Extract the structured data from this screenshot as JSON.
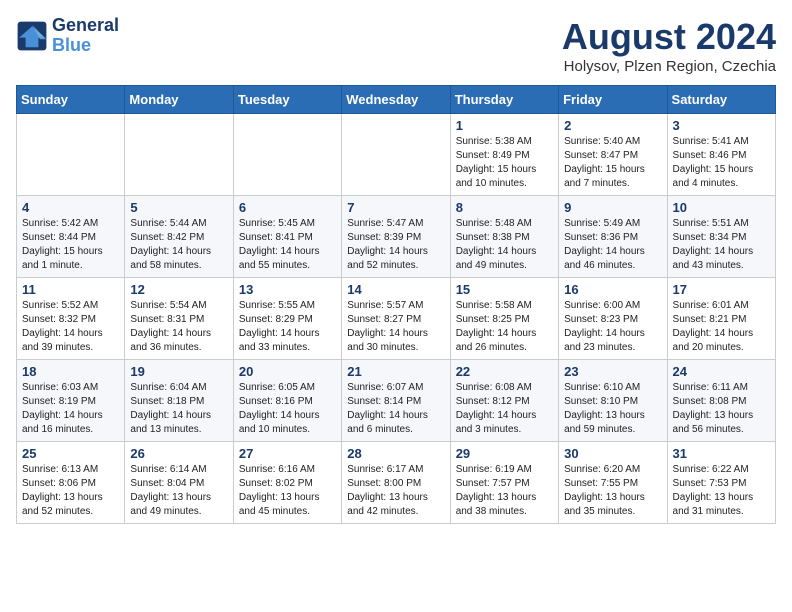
{
  "header": {
    "logo_line1": "General",
    "logo_line2": "Blue",
    "month_year": "August 2024",
    "location": "Holysov, Plzen Region, Czechia"
  },
  "days_of_week": [
    "Sunday",
    "Monday",
    "Tuesday",
    "Wednesday",
    "Thursday",
    "Friday",
    "Saturday"
  ],
  "weeks": [
    [
      {
        "day": "",
        "info": ""
      },
      {
        "day": "",
        "info": ""
      },
      {
        "day": "",
        "info": ""
      },
      {
        "day": "",
        "info": ""
      },
      {
        "day": "1",
        "info": "Sunrise: 5:38 AM\nSunset: 8:49 PM\nDaylight: 15 hours\nand 10 minutes."
      },
      {
        "day": "2",
        "info": "Sunrise: 5:40 AM\nSunset: 8:47 PM\nDaylight: 15 hours\nand 7 minutes."
      },
      {
        "day": "3",
        "info": "Sunrise: 5:41 AM\nSunset: 8:46 PM\nDaylight: 15 hours\nand 4 minutes."
      }
    ],
    [
      {
        "day": "4",
        "info": "Sunrise: 5:42 AM\nSunset: 8:44 PM\nDaylight: 15 hours\nand 1 minute."
      },
      {
        "day": "5",
        "info": "Sunrise: 5:44 AM\nSunset: 8:42 PM\nDaylight: 14 hours\nand 58 minutes."
      },
      {
        "day": "6",
        "info": "Sunrise: 5:45 AM\nSunset: 8:41 PM\nDaylight: 14 hours\nand 55 minutes."
      },
      {
        "day": "7",
        "info": "Sunrise: 5:47 AM\nSunset: 8:39 PM\nDaylight: 14 hours\nand 52 minutes."
      },
      {
        "day": "8",
        "info": "Sunrise: 5:48 AM\nSunset: 8:38 PM\nDaylight: 14 hours\nand 49 minutes."
      },
      {
        "day": "9",
        "info": "Sunrise: 5:49 AM\nSunset: 8:36 PM\nDaylight: 14 hours\nand 46 minutes."
      },
      {
        "day": "10",
        "info": "Sunrise: 5:51 AM\nSunset: 8:34 PM\nDaylight: 14 hours\nand 43 minutes."
      }
    ],
    [
      {
        "day": "11",
        "info": "Sunrise: 5:52 AM\nSunset: 8:32 PM\nDaylight: 14 hours\nand 39 minutes."
      },
      {
        "day": "12",
        "info": "Sunrise: 5:54 AM\nSunset: 8:31 PM\nDaylight: 14 hours\nand 36 minutes."
      },
      {
        "day": "13",
        "info": "Sunrise: 5:55 AM\nSunset: 8:29 PM\nDaylight: 14 hours\nand 33 minutes."
      },
      {
        "day": "14",
        "info": "Sunrise: 5:57 AM\nSunset: 8:27 PM\nDaylight: 14 hours\nand 30 minutes."
      },
      {
        "day": "15",
        "info": "Sunrise: 5:58 AM\nSunset: 8:25 PM\nDaylight: 14 hours\nand 26 minutes."
      },
      {
        "day": "16",
        "info": "Sunrise: 6:00 AM\nSunset: 8:23 PM\nDaylight: 14 hours\nand 23 minutes."
      },
      {
        "day": "17",
        "info": "Sunrise: 6:01 AM\nSunset: 8:21 PM\nDaylight: 14 hours\nand 20 minutes."
      }
    ],
    [
      {
        "day": "18",
        "info": "Sunrise: 6:03 AM\nSunset: 8:19 PM\nDaylight: 14 hours\nand 16 minutes."
      },
      {
        "day": "19",
        "info": "Sunrise: 6:04 AM\nSunset: 8:18 PM\nDaylight: 14 hours\nand 13 minutes."
      },
      {
        "day": "20",
        "info": "Sunrise: 6:05 AM\nSunset: 8:16 PM\nDaylight: 14 hours\nand 10 minutes."
      },
      {
        "day": "21",
        "info": "Sunrise: 6:07 AM\nSunset: 8:14 PM\nDaylight: 14 hours\nand 6 minutes."
      },
      {
        "day": "22",
        "info": "Sunrise: 6:08 AM\nSunset: 8:12 PM\nDaylight: 14 hours\nand 3 minutes."
      },
      {
        "day": "23",
        "info": "Sunrise: 6:10 AM\nSunset: 8:10 PM\nDaylight: 13 hours\nand 59 minutes."
      },
      {
        "day": "24",
        "info": "Sunrise: 6:11 AM\nSunset: 8:08 PM\nDaylight: 13 hours\nand 56 minutes."
      }
    ],
    [
      {
        "day": "25",
        "info": "Sunrise: 6:13 AM\nSunset: 8:06 PM\nDaylight: 13 hours\nand 52 minutes."
      },
      {
        "day": "26",
        "info": "Sunrise: 6:14 AM\nSunset: 8:04 PM\nDaylight: 13 hours\nand 49 minutes."
      },
      {
        "day": "27",
        "info": "Sunrise: 6:16 AM\nSunset: 8:02 PM\nDaylight: 13 hours\nand 45 minutes."
      },
      {
        "day": "28",
        "info": "Sunrise: 6:17 AM\nSunset: 8:00 PM\nDaylight: 13 hours\nand 42 minutes."
      },
      {
        "day": "29",
        "info": "Sunrise: 6:19 AM\nSunset: 7:57 PM\nDaylight: 13 hours\nand 38 minutes."
      },
      {
        "day": "30",
        "info": "Sunrise: 6:20 AM\nSunset: 7:55 PM\nDaylight: 13 hours\nand 35 minutes."
      },
      {
        "day": "31",
        "info": "Sunrise: 6:22 AM\nSunset: 7:53 PM\nDaylight: 13 hours\nand 31 minutes."
      }
    ]
  ]
}
